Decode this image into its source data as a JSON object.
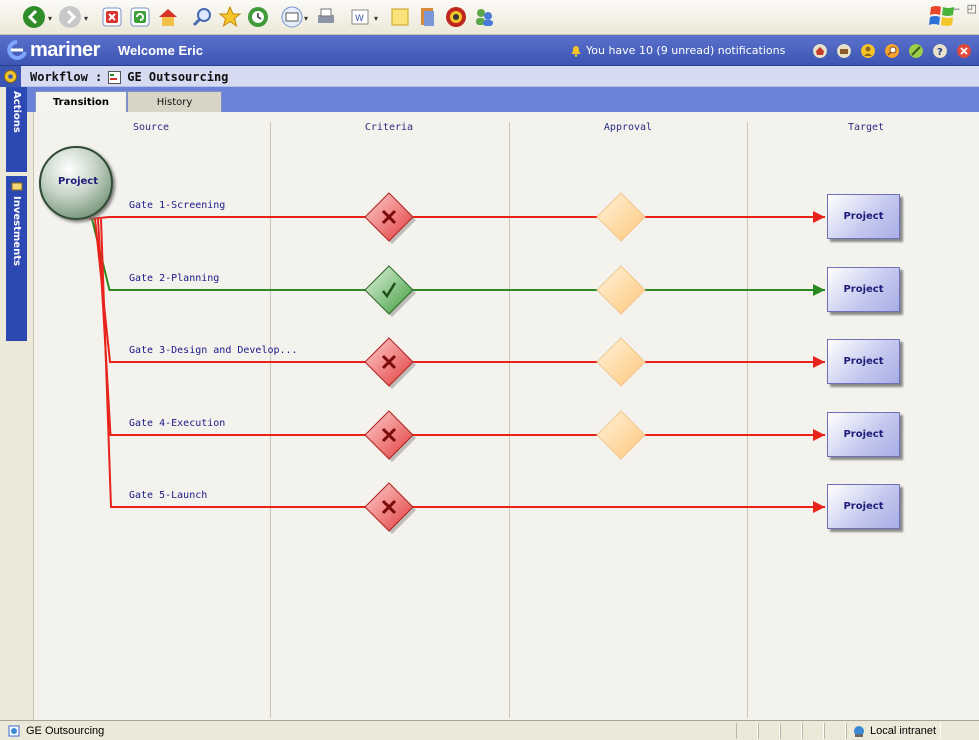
{
  "toolbar": {
    "icons": [
      "back-icon",
      "forward-icon",
      "stop-icon",
      "refresh-icon",
      "home-icon",
      "search-icon",
      "favorites-icon",
      "history-icon",
      "mail-icon",
      "print-icon",
      "edit-icon",
      "discuss-icon",
      "messenger-icon",
      "research-icon",
      "users-icon"
    ]
  },
  "header": {
    "brand": "mariner",
    "welcome": "Welcome Eric",
    "notification": "You have 10 (9 unread) notifications"
  },
  "breadcrumb": {
    "label": "Workflow :",
    "title": "GE Outsourcing"
  },
  "side_tabs": {
    "actions": "Actions",
    "investments": "Investments"
  },
  "tabs": {
    "transition": "Transition",
    "history": "History"
  },
  "columns": {
    "source": "Source",
    "criteria": "Criteria",
    "approval": "Approval",
    "target": "Target"
  },
  "source_node": "Project",
  "gates": [
    {
      "label": "Gate 1-Screening",
      "status": "fail",
      "has_approval": true,
      "target": "Project"
    },
    {
      "label": "Gate 2-Planning",
      "status": "pass",
      "has_approval": true,
      "target": "Project"
    },
    {
      "label": "Gate 3-Design and Develop...",
      "status": "fail",
      "has_approval": true,
      "target": "Project"
    },
    {
      "label": "Gate 4-Execution",
      "status": "fail",
      "has_approval": true,
      "target": "Project"
    },
    {
      "label": "Gate 5-Launch",
      "status": "fail",
      "has_approval": false,
      "target": "Project"
    }
  ],
  "colors": {
    "fail_line": "#e8231c",
    "pass_line": "#2c8a22",
    "header_blue": "#3d55b3",
    "approval_diamond": "#ffd9a3"
  },
  "status_bar": {
    "text": "GE Outsourcing",
    "zone": "Local intranet"
  }
}
